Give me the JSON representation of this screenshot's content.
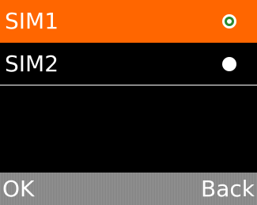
{
  "sim_list": {
    "items": [
      {
        "label": "SIM1",
        "selected": true,
        "radio_state": "checked"
      },
      {
        "label": "SIM2",
        "selected": false,
        "radio_state": "unchecked"
      }
    ]
  },
  "softkeys": {
    "left_label": "OK",
    "right_label": "Back"
  },
  "colors": {
    "highlight": "#ff6600",
    "background": "#000000",
    "softkey_bar": "#8a8a8a",
    "radio_checked_dot": "#2d8a2d",
    "text": "#ffffff"
  }
}
